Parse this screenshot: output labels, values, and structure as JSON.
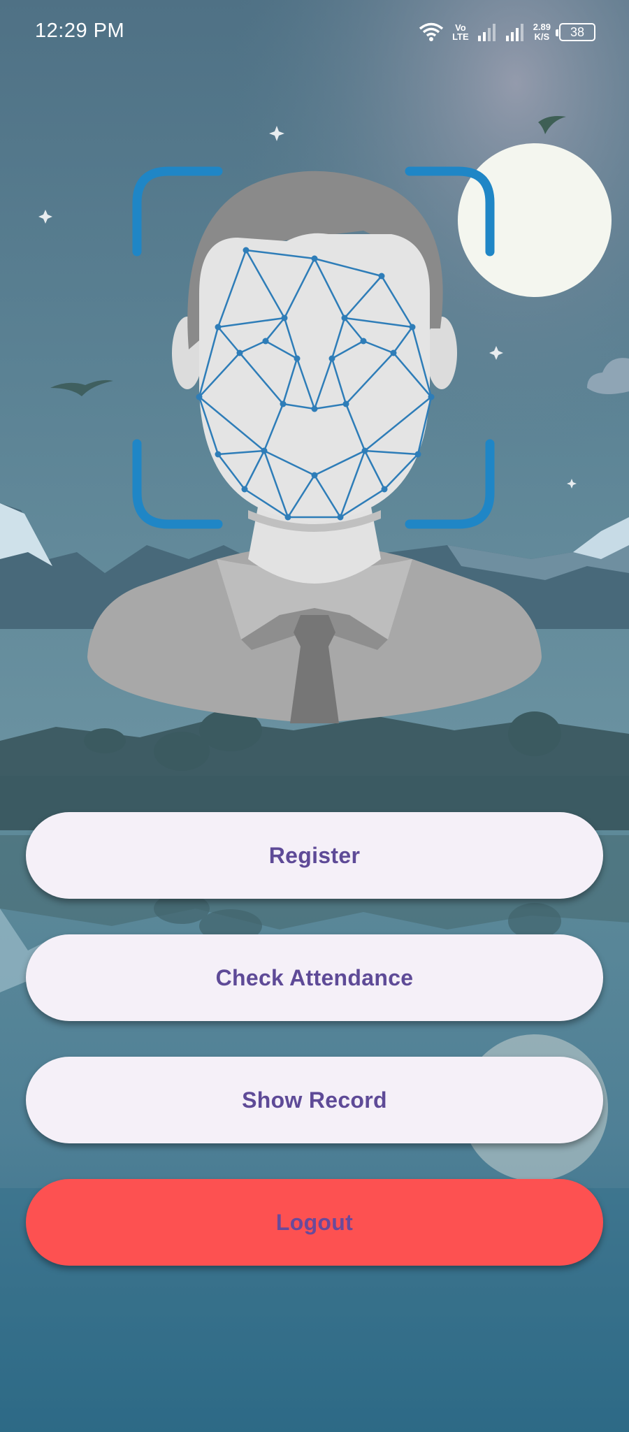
{
  "status_bar": {
    "time": "12:29 PM",
    "volte_top": "Vo",
    "volte_bottom": "LTE",
    "speed_value": "2.89",
    "speed_unit": "K/S",
    "battery": "38",
    "icons": [
      "wifi-icon",
      "signal-icon",
      "signal-icon",
      "battery-icon"
    ]
  },
  "hero": {
    "illustration": "face-recognition-illustration",
    "icons": [
      "scan-frame-icon",
      "face-mesh-icon",
      "person-avatar-icon",
      "moon-icon"
    ]
  },
  "actions": {
    "register": "Register",
    "check_attendance": "Check Attendance",
    "show_record": "Show Record",
    "logout": "Logout"
  },
  "colors": {
    "button_bg": "#f5f0f8",
    "button_text": "#5e4a97",
    "logout_bg": "#fd5151",
    "scan_frame": "#1f86c6",
    "mesh": "#2e7db8"
  }
}
